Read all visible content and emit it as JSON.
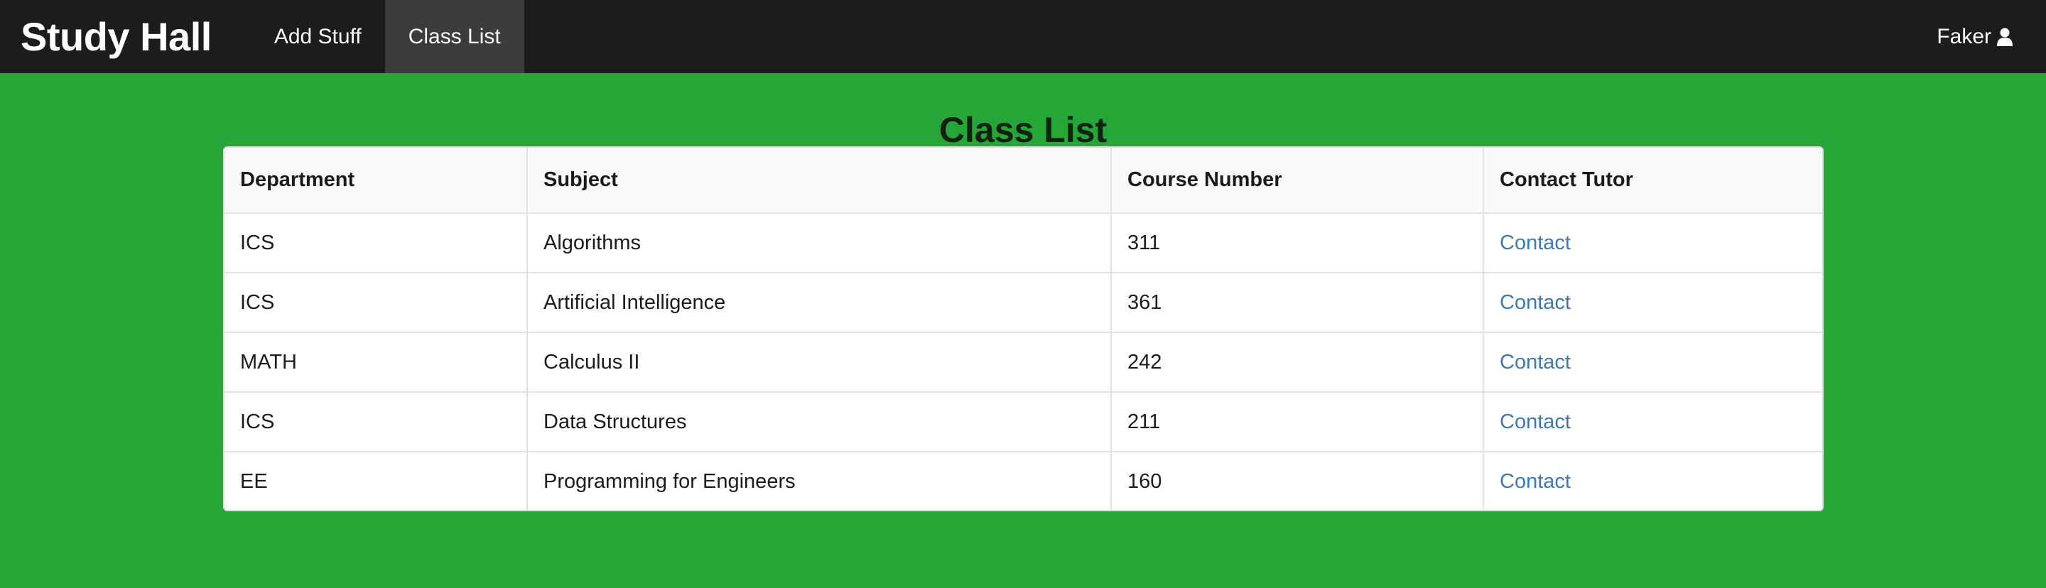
{
  "navbar": {
    "brand": "Study Hall",
    "links": [
      {
        "label": "Add Stuff"
      },
      {
        "label": "Class List",
        "active": true
      }
    ],
    "user": {
      "label": "Faker",
      "icon": "user-icon"
    }
  },
  "page": {
    "title": "Class List"
  },
  "colors": {
    "background": "#25a636",
    "navbar": "#1b1c1e",
    "nav_active": "#3b3c3e",
    "link": "#3a78b8"
  },
  "table": {
    "headers": [
      "Department",
      "Subject",
      "Course Number",
      "Contact Tutor"
    ],
    "rows": [
      {
        "department": "ICS",
        "subject": "Algorithms",
        "course_number": "311",
        "contact": "Contact"
      },
      {
        "department": "ICS",
        "subject": "Artificial Intelligence",
        "course_number": "361",
        "contact": "Contact"
      },
      {
        "department": "MATH",
        "subject": "Calculus II",
        "course_number": "242",
        "contact": "Contact"
      },
      {
        "department": "ICS",
        "subject": "Data Structures",
        "course_number": "211",
        "contact": "Contact"
      },
      {
        "department": "EE",
        "subject": "Programming for Engineers",
        "course_number": "160",
        "contact": "Contact"
      }
    ]
  }
}
